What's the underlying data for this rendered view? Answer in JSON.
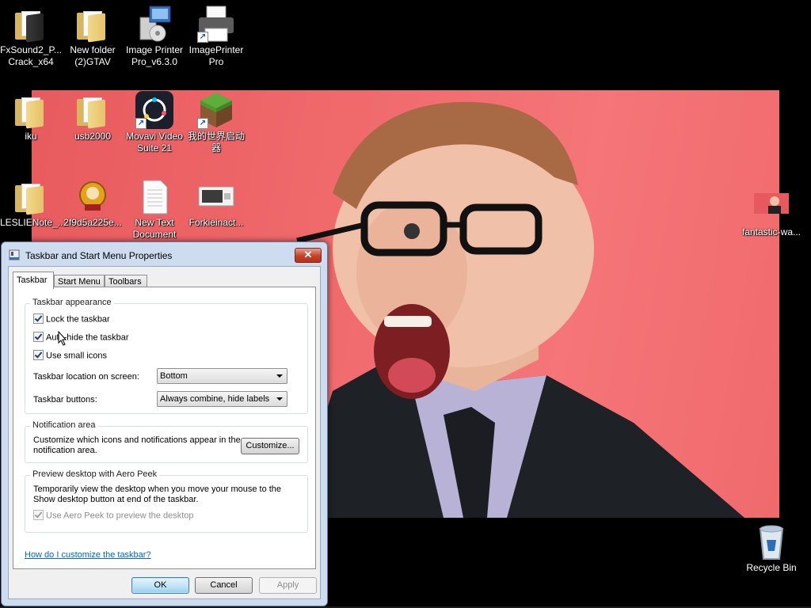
{
  "desktop": {
    "icons": [
      {
        "label": "FxSound2_P... Crack_x64"
      },
      {
        "label": "New folder (2)GTAV"
      },
      {
        "label": "Image Printer Pro_v6.3.0"
      },
      {
        "label": "ImagePrinter Pro"
      },
      {
        "label": "iku"
      },
      {
        "label": "usb2000"
      },
      {
        "label": "Movavi Video Suite 21"
      },
      {
        "label": "我的世界启动器"
      },
      {
        "label": "LESLIENote_..."
      },
      {
        "label": "2f9d5a225e..."
      },
      {
        "label": "New Text Document"
      },
      {
        "label": "Forkieinact..."
      },
      {
        "label": "fantastic-wa..."
      },
      {
        "label": "Recycle Bin"
      }
    ]
  },
  "dialog": {
    "title": "Taskbar and Start Menu Properties",
    "close_glyph": "✕",
    "tabs": [
      {
        "label": "Taskbar"
      },
      {
        "label": "Start Menu"
      },
      {
        "label": "Toolbars"
      }
    ],
    "appearance": {
      "title": "Taskbar appearance",
      "lock": "Lock the taskbar",
      "autohide": "Auto-hide the taskbar",
      "small_icons": "Use small icons",
      "location_label": "Taskbar location on screen:",
      "location_value": "Bottom",
      "buttons_label": "Taskbar buttons:",
      "buttons_value": "Always combine, hide labels"
    },
    "notification": {
      "title": "Notification area",
      "desc": "Customize which icons and notifications appear in the notification area.",
      "button": "Customize..."
    },
    "peek": {
      "title": "Preview desktop with Aero Peek",
      "desc": "Temporarily view the desktop when you move your mouse to the Show desktop button at end of the taskbar.",
      "checkbox": "Use Aero Peek to preview the desktop"
    },
    "help_link": "How do I customize the taskbar?",
    "ok": "OK",
    "cancel": "Cancel",
    "apply": "Apply"
  },
  "colors": {
    "wallpaper": "#f06a6c",
    "link": "#0066cc",
    "close_button": "#c5412b"
  }
}
